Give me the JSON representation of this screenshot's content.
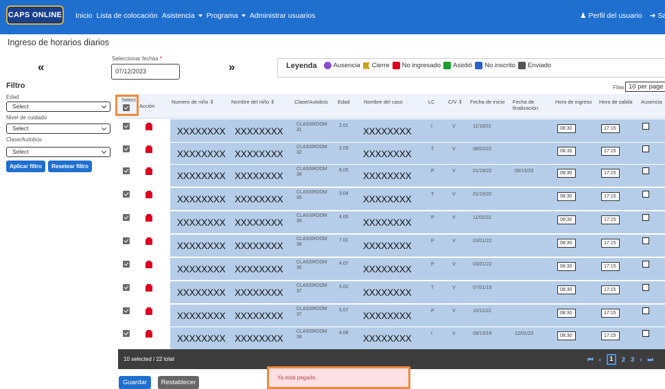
{
  "nav": {
    "logo": "CAPS ONLINE",
    "links": [
      "Inicio",
      "Lista de colocación",
      "Asistencia",
      "Programa",
      "Administrar usuarios"
    ],
    "profile": "Perfil del usuario",
    "logout": "Sa"
  },
  "page": {
    "title": "Ingreso de horarios diarios"
  },
  "date": {
    "label": "Seleccionar fechas",
    "required_mark": "*",
    "value": "07/12/2023",
    "prev_icon": "«",
    "next_icon": "»"
  },
  "legend": {
    "title": "Leyenda",
    "items": [
      "Ausencia",
      "Cierre",
      "No ingresado",
      "Asistió",
      "No inscrito",
      "Enviado"
    ]
  },
  "filter": {
    "title": "Filtro",
    "fields": [
      {
        "label": "Edad",
        "value": "Select"
      },
      {
        "label": "Nivel de cuidado",
        "value": "Select"
      },
      {
        "label": "Clase/Autobús",
        "value": "Select"
      }
    ],
    "apply": "Aplicar filtro",
    "reset": "Resetear filtro"
  },
  "rows_per_page": {
    "label": "Filas",
    "value": "10 per page"
  },
  "table": {
    "headers": {
      "select": "Select",
      "action": "Acción",
      "child_number": "Numero de niño ⇕",
      "child_name": "Nombre del niño ⇕",
      "class": "Clase/Autobús",
      "age": "Edad",
      "case_name": "Nombre del caso",
      "lc": "LC",
      "cv": "C/V ⇕",
      "start": "Fecha de inicio",
      "end_l1": "Fecha de",
      "end_l2": "finalización",
      "in": "Hora de ingreso",
      "out": "Hora de salida",
      "absence": "Ausencia"
    },
    "rows": [
      {
        "num": "XXXXXXXX",
        "name": "XXXXXXXX",
        "class1": "CLASSROOM",
        "class2": "31",
        "age": "2.01",
        "case": "XXXXXXXX",
        "lc": "I",
        "cv": "V",
        "start": "11/19/21",
        "end": "",
        "in": "08:30",
        "out": "17:15"
      },
      {
        "num": "XXXXXXXX",
        "name": "XXXXXXXX",
        "class1": "CLASSROOM",
        "class2": "32",
        "age": "2.09",
        "case": "XXXXXXXX",
        "lc": "T",
        "cv": "V",
        "start": "08/02/22",
        "end": "",
        "in": "08:30",
        "out": "17:15"
      },
      {
        "num": "XXXXXXXX",
        "name": "XXXXXXXX",
        "class1": "CLASSROOM",
        "class2": "38",
        "age": "6.05",
        "case": "XXXXXXXX",
        "lc": "P",
        "cv": "V",
        "start": "01/19/22",
        "end": "09/15/23",
        "in": "08:30",
        "out": "17:15"
      },
      {
        "num": "XXXXXXXX",
        "name": "XXXXXXXX",
        "class1": "CLASSROOM",
        "class2": "35",
        "age": "3.04",
        "case": "XXXXXXXX",
        "lc": "T",
        "cv": "V",
        "start": "01/19/22",
        "end": "",
        "in": "08:30",
        "out": "17:15"
      },
      {
        "num": "XXXXXXXX",
        "name": "XXXXXXXX",
        "class1": "CLASSROOM",
        "class2": "35",
        "age": "4.00",
        "case": "XXXXXXXX",
        "lc": "P",
        "cv": "V",
        "start": "11/02/22",
        "end": "",
        "in": "08:30",
        "out": "17:15"
      },
      {
        "num": "XXXXXXXX",
        "name": "XXXXXXXX",
        "class1": "CLASSROOM",
        "class2": "38",
        "age": "7.01",
        "case": "XXXXXXXX",
        "lc": "P",
        "cv": "V",
        "start": "03/01/22",
        "end": "",
        "in": "08:30",
        "out": "17:15"
      },
      {
        "num": "XXXXXXXX",
        "name": "XXXXXXXX",
        "class1": "CLASSROOM",
        "class2": "36",
        "age": "4.07",
        "case": "XXXXXXXX",
        "lc": "P",
        "cv": "V",
        "start": "03/01/22",
        "end": "",
        "in": "08:30",
        "out": "17:15"
      },
      {
        "num": "XXXXXXXX",
        "name": "XXXXXXXX",
        "class1": "CLASSROOM",
        "class2": "37",
        "age": "6.02",
        "case": "XXXXXXXX",
        "lc": "T",
        "cv": "V",
        "start": "07/01/19",
        "end": "",
        "in": "08:30",
        "out": "17:15"
      },
      {
        "num": "XXXXXXXX",
        "name": "XXXXXXXX",
        "class1": "CLASSROOM",
        "class2": "37",
        "age": "5.07",
        "case": "XXXXXXXX",
        "lc": "P",
        "cv": "V",
        "start": "10/11/22",
        "end": "",
        "in": "08:30",
        "out": "17:15"
      },
      {
        "num": "XXXXXXXX",
        "name": "XXXXXXXX",
        "class1": "CLASSROOM",
        "class2": "38",
        "age": "4.08",
        "case": "XXXXXXXX",
        "lc": "I",
        "cv": "V",
        "start": "09/13/19",
        "end": "12/01/23",
        "in": "08:30",
        "out": "17:15"
      }
    ],
    "summary": "10 selected / 22 total",
    "pages": [
      "1",
      "2",
      "3"
    ],
    "current_page": "1"
  },
  "actions": {
    "save": "Guardar",
    "reset": "Restablecer"
  },
  "toast": {
    "message": "Ya está pegado."
  },
  "colors": {
    "navbar": "#1f6fcf",
    "row_highlight": "#b5cde8",
    "highlight_border": "#ee8a3a",
    "toast_bg": "#fce0e3"
  }
}
